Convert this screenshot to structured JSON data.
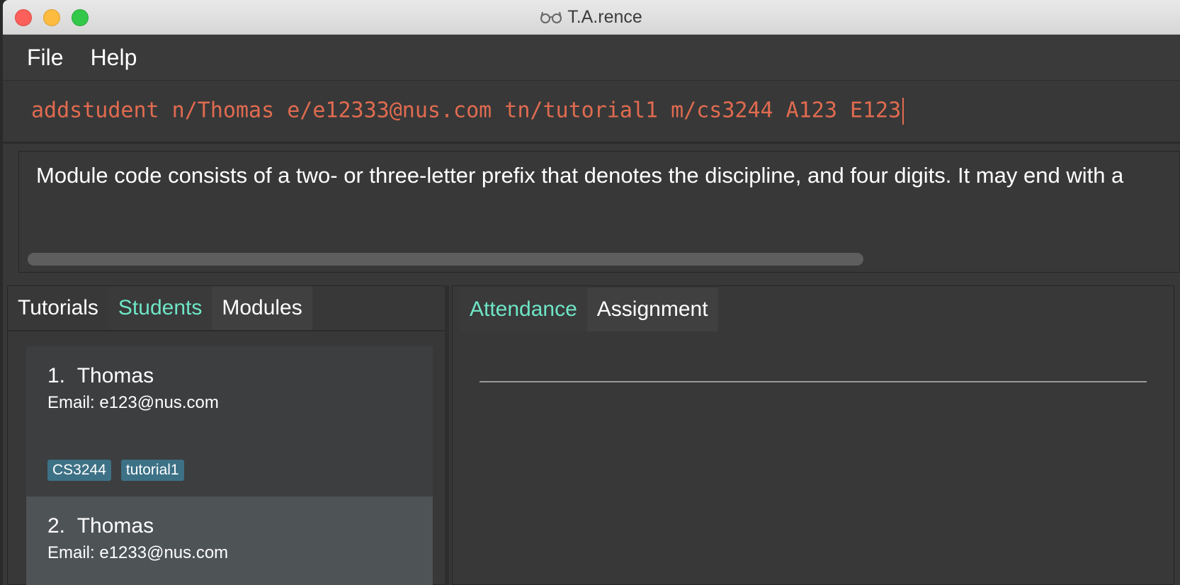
{
  "window": {
    "title": "T.A.rence"
  },
  "menu": {
    "items": [
      "File",
      "Help"
    ]
  },
  "command_box": {
    "value": "addstudent n/Thomas e/e12333@nus.com tn/tutorial1 m/cs3244 A123 E123"
  },
  "result_display": {
    "text": "Module code consists of a two- or three-letter prefix that denotes the discipline, and four digits. It may end with a"
  },
  "left_tabs": [
    {
      "label": "Tutorials",
      "active": false
    },
    {
      "label": "Students",
      "active": true
    },
    {
      "label": "Modules",
      "active": false
    }
  ],
  "students": [
    {
      "index": "1.",
      "name": "Thomas",
      "email": "Email: e123@nus.com",
      "tags": [
        "CS3244",
        "tutorial1"
      ]
    },
    {
      "index": "2.",
      "name": "Thomas",
      "email": "Email: e1233@nus.com",
      "tags": []
    }
  ],
  "right_tabs": [
    {
      "label": "Attendance",
      "active": true
    },
    {
      "label": "Assignment",
      "active": false
    }
  ],
  "colors": {
    "accent": "#6ee6c6",
    "command_text": "#e06b50",
    "tag_bg": "#3d7186",
    "background": "#383838"
  }
}
